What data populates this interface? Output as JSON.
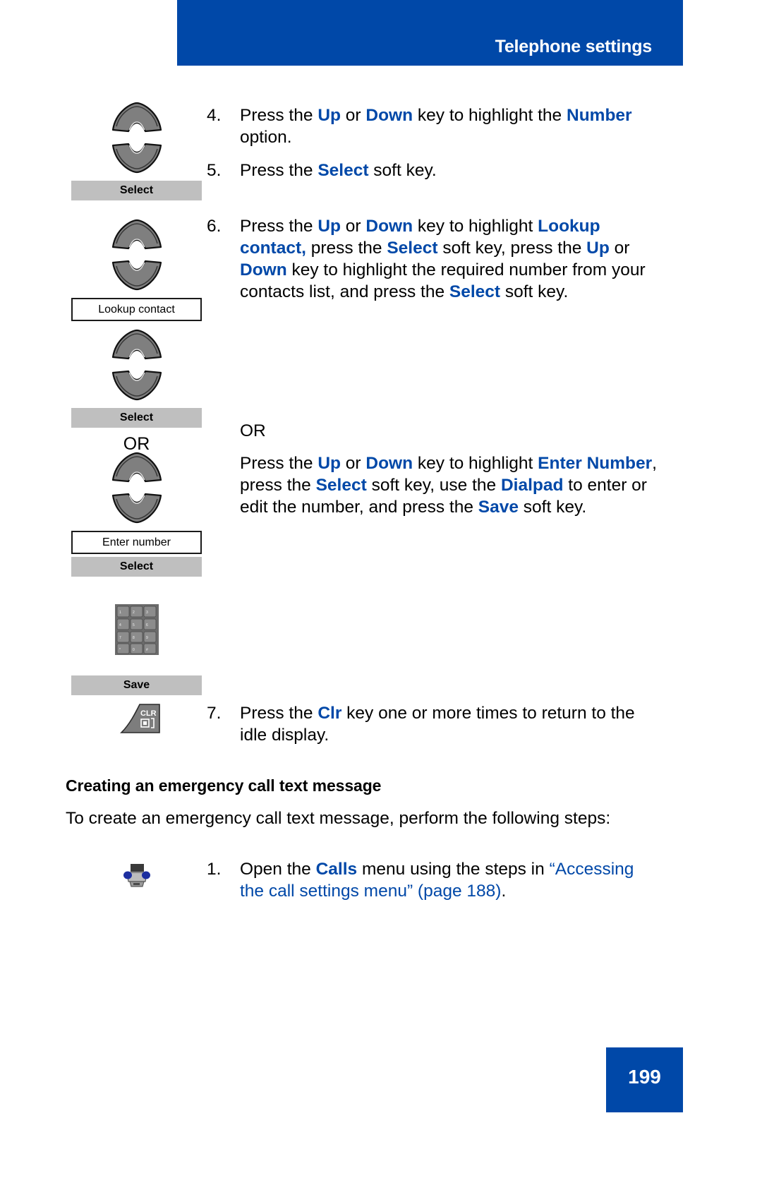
{
  "header": {
    "title": "Telephone settings",
    "bar_color": "#0048a8"
  },
  "colors": {
    "accent": "#0048a8",
    "softkey_gray": "#bfbfbf",
    "key_gray": "#808080"
  },
  "icon_column": {
    "softkey_select_1": "Select",
    "display_lookup_contact": "Lookup contact",
    "softkey_select_2": "Select",
    "or_label": "OR",
    "display_enter_number": "Enter number",
    "softkey_select_3": "Select",
    "softkey_save": "Save",
    "clr_key_label": "CLR",
    "icons": {
      "nav_up": "navigation-up-key-icon",
      "nav_down": "navigation-down-key-icon",
      "dialpad": "dialpad-icon",
      "clr": "clr-key-icon",
      "calls_menu": "calls-menu-phone-icon"
    }
  },
  "steps": [
    {
      "number": "4.",
      "parts": [
        {
          "t": "Press the ",
          "style": "plain"
        },
        {
          "t": "Up",
          "style": "kw"
        },
        {
          "t": " or ",
          "style": "plain"
        },
        {
          "t": "Down",
          "style": "kw"
        },
        {
          "t": " key to highlight the ",
          "style": "plain"
        },
        {
          "t": "Number",
          "style": "kw"
        },
        {
          "t": " option.",
          "style": "plain"
        }
      ]
    },
    {
      "number": "5.",
      "parts": [
        {
          "t": "Press the ",
          "style": "plain"
        },
        {
          "t": "Select",
          "style": "kw"
        },
        {
          "t": " soft key.",
          "style": "plain"
        }
      ]
    },
    {
      "number": "6.",
      "parts": [
        {
          "t": "Press the ",
          "style": "plain"
        },
        {
          "t": "Up",
          "style": "kw"
        },
        {
          "t": " or ",
          "style": "plain"
        },
        {
          "t": "Down",
          "style": "kw"
        },
        {
          "t": " key to highlight ",
          "style": "plain"
        },
        {
          "t": "Lookup contact,",
          "style": "kw"
        },
        {
          "t": " press the ",
          "style": "plain"
        },
        {
          "t": "Select",
          "style": "kw"
        },
        {
          "t": " soft key, press the ",
          "style": "plain"
        },
        {
          "t": "Up",
          "style": "kw"
        },
        {
          "t": " or ",
          "style": "plain"
        },
        {
          "t": "Down",
          "style": "kw"
        },
        {
          "t": " key to highlight the required number from your contacts list, and press the ",
          "style": "plain"
        },
        {
          "t": "Select",
          "style": "kw"
        },
        {
          "t": " soft key.",
          "style": "plain"
        }
      ]
    }
  ],
  "or_block": {
    "or_label": "OR",
    "parts": [
      {
        "t": "Press the ",
        "style": "plain"
      },
      {
        "t": "Up",
        "style": "kw"
      },
      {
        "t": " or ",
        "style": "plain"
      },
      {
        "t": "Down",
        "style": "kw"
      },
      {
        "t": " key to highlight ",
        "style": "plain"
      },
      {
        "t": "Enter Number",
        "style": "kw"
      },
      {
        "t": ", press the ",
        "style": "plain"
      },
      {
        "t": "Select",
        "style": "kw"
      },
      {
        "t": " soft key, use the ",
        "style": "plain"
      },
      {
        "t": "Dialpad",
        "style": "kw"
      },
      {
        "t": " to enter or edit the number, and press the ",
        "style": "plain"
      },
      {
        "t": "Save",
        "style": "kw"
      },
      {
        "t": " soft key.",
        "style": "plain"
      }
    ]
  },
  "step7": {
    "number": "7.",
    "parts": [
      {
        "t": "Press the ",
        "style": "plain"
      },
      {
        "t": "Clr",
        "style": "kw"
      },
      {
        "t": " key one or more times to return to the idle display.",
        "style": "plain"
      }
    ]
  },
  "section": {
    "heading": "Creating an emergency call text message",
    "intro": "To create an emergency call text message, perform the following steps:"
  },
  "step1": {
    "number": "1.",
    "parts": [
      {
        "t": "Open the ",
        "style": "plain"
      },
      {
        "t": "Calls",
        "style": "kw"
      },
      {
        "t": " menu using the steps in ",
        "style": "plain"
      },
      {
        "t": "“Accessing the call settings menu” (page 188)",
        "style": "link"
      },
      {
        "t": ".",
        "style": "plain"
      }
    ]
  },
  "footer": {
    "page_number": "199"
  }
}
